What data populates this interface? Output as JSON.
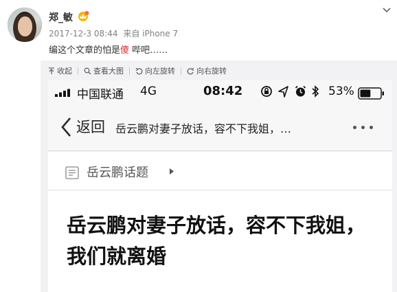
{
  "post": {
    "username": "郑_敏",
    "timestamp": "2017-12-3 08:44",
    "source": "来自 iPhone 7",
    "text_before": "编这个文章的怕是",
    "text_highlight": "傻",
    "text_after": " 哔吧……"
  },
  "toolbar": {
    "collapse": "收起",
    "view_large": "查看大图",
    "rotate_left": "向左旋转",
    "rotate_right": "向右旋转"
  },
  "phone": {
    "carrier": "中国联通",
    "network": "4G",
    "time": "08:42",
    "battery_pct": "53%",
    "battery_level": 0.53,
    "back_label": "返回",
    "nav_title": "岳云鹏对妻子放话，容不下我姐，…",
    "topic_label": "岳云鹏话题",
    "headline": "岳云鹏对妻子放话，容不下我姐，我们就离婚"
  },
  "colors": {
    "highlight_red": "#e52e2e",
    "panel_bg": "#f2f2f5",
    "meta_gray": "#808080"
  },
  "icons": [
    "vip-crown-icon",
    "chevron-down-icon",
    "collapse-icon",
    "search-icon",
    "rotate-left-icon",
    "rotate-right-icon",
    "signal-icon",
    "lock-rotation-icon",
    "location-icon",
    "alarm-icon",
    "bluetooth-icon",
    "battery-icon",
    "back-arrow-icon",
    "more-icon",
    "topic-icon",
    "caret-right-icon"
  ]
}
